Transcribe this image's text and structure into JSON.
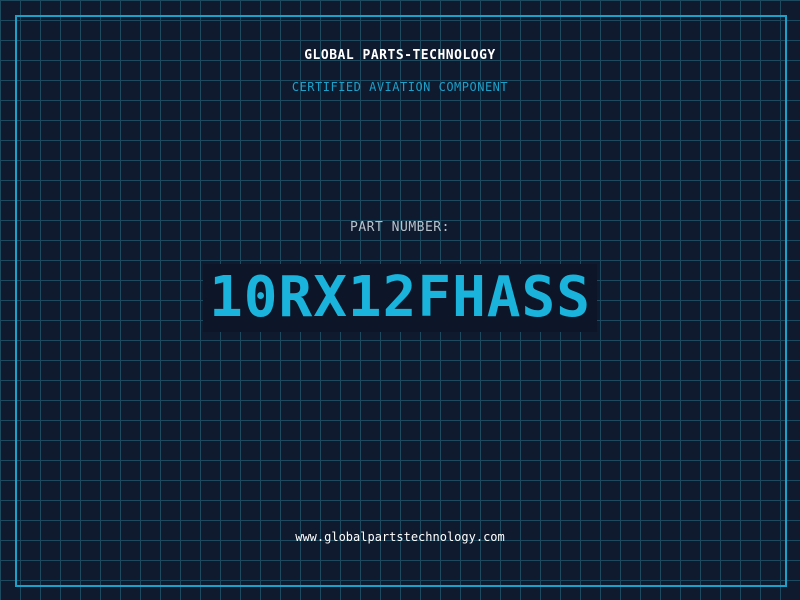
{
  "header": {
    "company": "GLOBAL PARTS-TECHNOLOGY",
    "subtitle": "CERTIFIED AVIATION COMPONENT"
  },
  "part": {
    "label": "PART NUMBER:",
    "number": "10RX12FHASS"
  },
  "footer": {
    "website": "www.globalpartstechnology.com"
  },
  "colors": {
    "background": "#0f1a2f",
    "grid": "#1d4a5f",
    "accent": "#1ba0c9",
    "part_number": "#19b3db"
  }
}
